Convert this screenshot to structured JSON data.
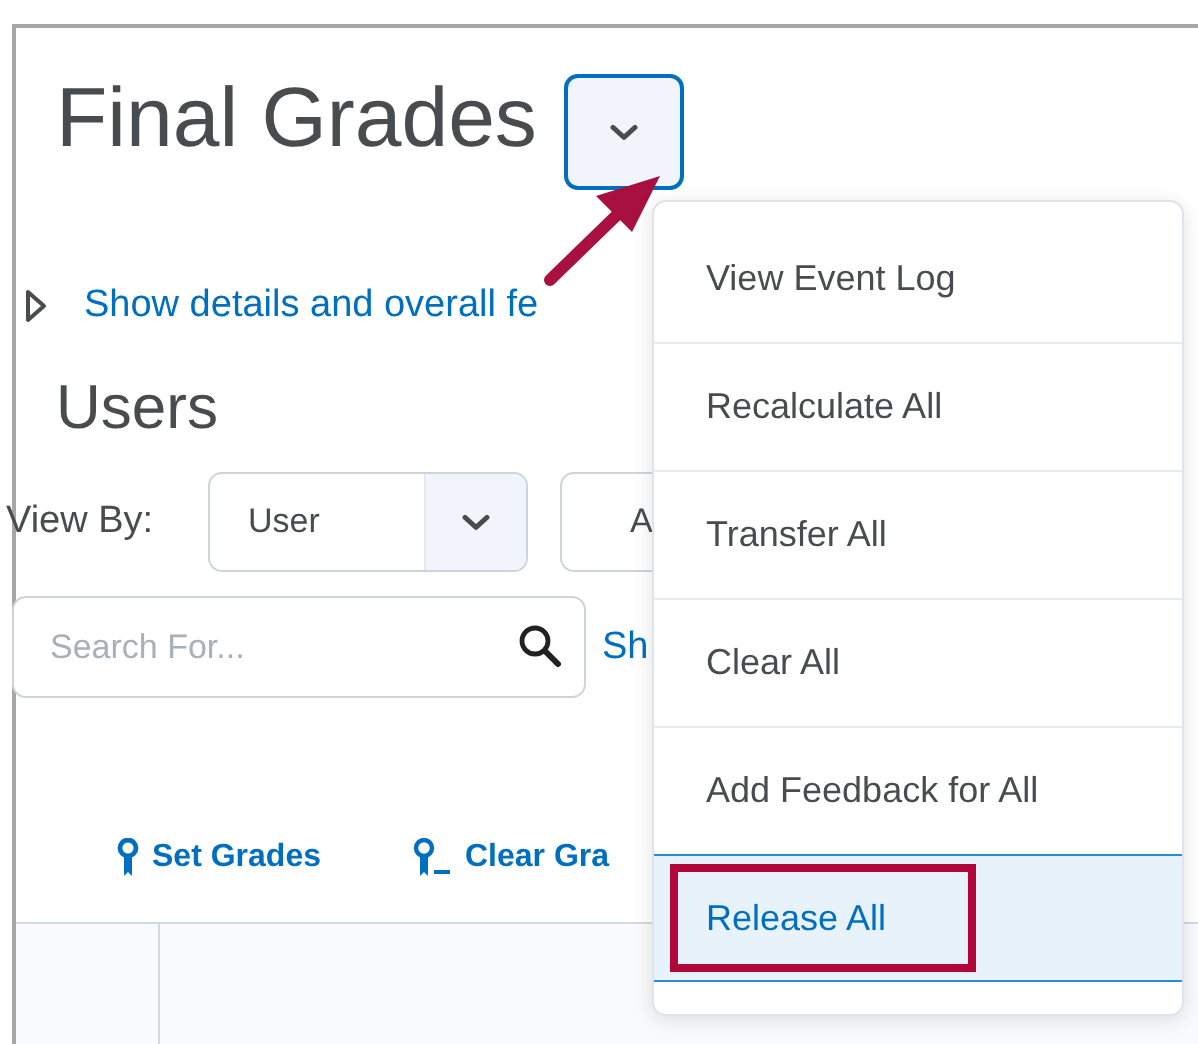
{
  "page": {
    "title": "Final Grades",
    "details_link": "Show details and overall fe",
    "section_heading": "Users"
  },
  "view_by": {
    "label": "View By:",
    "value": "User",
    "second_select": "A"
  },
  "search": {
    "placeholder": "Search For...",
    "link": "Sh"
  },
  "actions": [
    {
      "label": "Set Grades",
      "kind": "set"
    },
    {
      "label": "Clear Gra",
      "kind": "clear"
    }
  ],
  "menu": [
    {
      "label": "View Event Log",
      "selected": false,
      "annotated": false
    },
    {
      "label": "Recalculate All",
      "selected": false,
      "annotated": false
    },
    {
      "label": "Transfer All",
      "selected": false,
      "annotated": false
    },
    {
      "label": "Clear All",
      "selected": false,
      "annotated": false
    },
    {
      "label": "Add Feedback for All",
      "selected": false,
      "annotated": false
    },
    {
      "label": "Release All",
      "selected": true,
      "annotated": true
    }
  ]
}
